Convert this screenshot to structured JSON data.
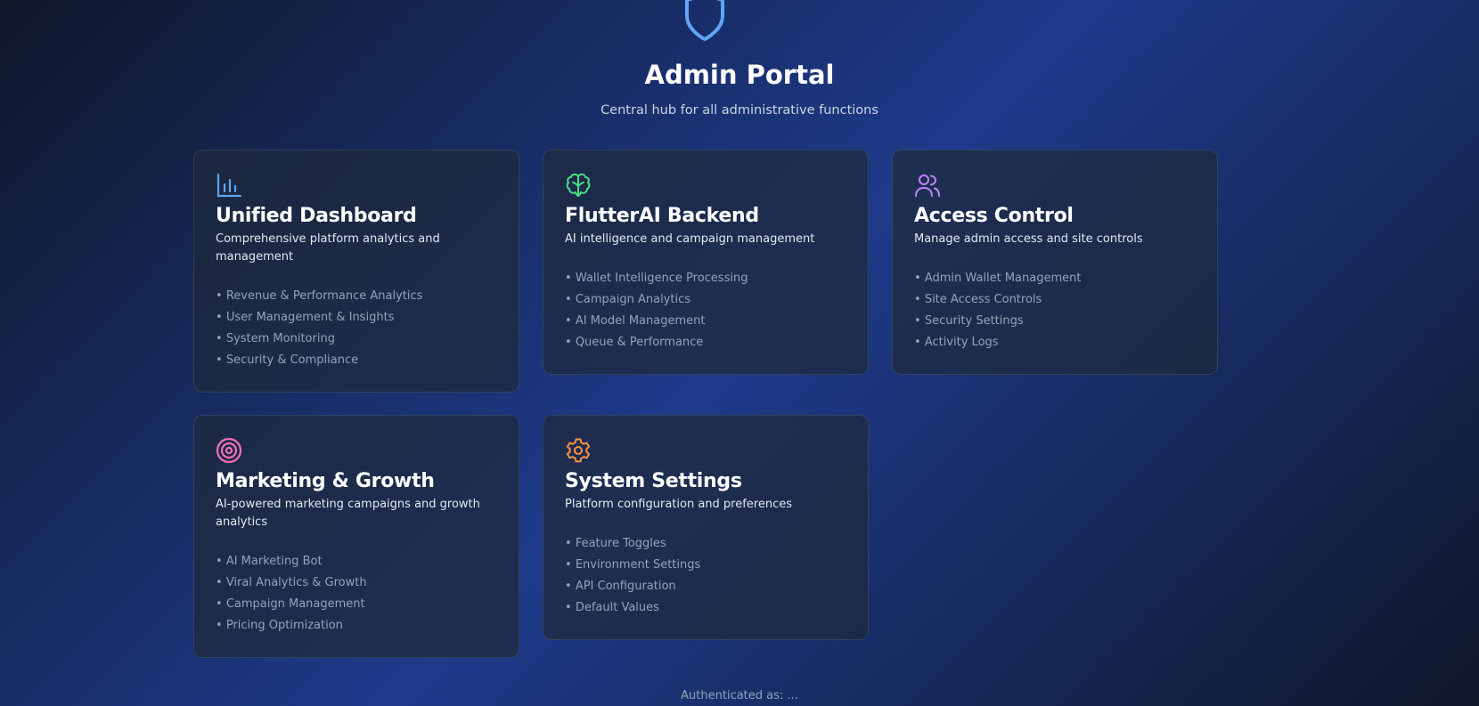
{
  "header": {
    "icon": "shield-icon",
    "title": "Admin Portal",
    "subtitle": "Central hub for all administrative functions"
  },
  "cards": [
    {
      "icon": "bar-chart-icon",
      "icon_color": "#60a5fa",
      "title": "Unified Dashboard",
      "description": "Comprehensive platform analytics and management",
      "features": [
        "Revenue & Performance Analytics",
        "User Management & Insights",
        "System Monitoring",
        "Security & Compliance"
      ]
    },
    {
      "icon": "brain-icon",
      "icon_color": "#4ade80",
      "title": "FlutterAI Backend",
      "description": "AI intelligence and campaign management",
      "features": [
        "Wallet Intelligence Processing",
        "Campaign Analytics",
        "AI Model Management",
        "Queue & Performance"
      ]
    },
    {
      "icon": "users-icon",
      "icon_color": "#c084fc",
      "title": "Access Control",
      "description": "Manage admin access and site controls",
      "features": [
        "Admin Wallet Management",
        "Site Access Controls",
        "Security Settings",
        "Activity Logs"
      ]
    },
    {
      "icon": "target-icon",
      "icon_color": "#f472b6",
      "title": "Marketing & Growth",
      "description": "AI-powered marketing campaigns and growth analytics",
      "features": [
        "AI Marketing Bot",
        "Viral Analytics & Growth",
        "Campaign Management",
        "Pricing Optimization"
      ]
    },
    {
      "icon": "gear-icon",
      "icon_color": "#fb923c",
      "title": "System Settings",
      "description": "Platform configuration and preferences",
      "features": [
        "Feature Toggles",
        "Environment Settings",
        "API Configuration",
        "Default Values"
      ]
    }
  ],
  "footer": {
    "auth_text": "Authenticated as: ..."
  }
}
